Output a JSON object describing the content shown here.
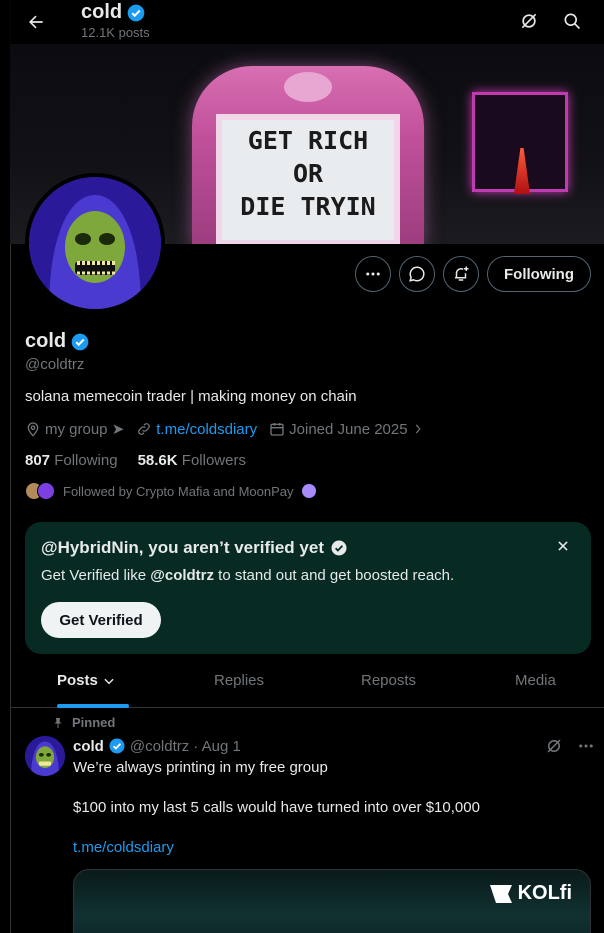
{
  "topbar": {
    "name": "cold",
    "posts_count": "12.1K posts"
  },
  "banner": {
    "sign_lines": [
      "GET RICH",
      "OR",
      "DIE TRYIN"
    ]
  },
  "profile": {
    "name": "cold",
    "handle": "@coldtrz",
    "bio": "solana memecoin trader | making money on chain",
    "location": "my group ➤",
    "link": "t.me/coldsdiary",
    "joined": "Joined June 2025",
    "following_count": "807",
    "following_label": "Following",
    "followers_count": "58.6K",
    "followers_label": "Followers",
    "followed_by": "Followed by Crypto Mafia and MoonPay",
    "following_button": "Following"
  },
  "verify_card": {
    "title": "@HybridNin, you aren’t verified yet",
    "subtitle_prefix": "Get Verified like ",
    "subtitle_handle": "@coldtrz",
    "subtitle_suffix": " to stand out and get boosted reach.",
    "button": "Get Verified"
  },
  "tabs": [
    {
      "label": "Posts"
    },
    {
      "label": "Replies"
    },
    {
      "label": "Reposts"
    },
    {
      "label": "Media"
    }
  ],
  "post": {
    "pinned_label": "Pinned",
    "author": "cold",
    "handle": "@coldtrz",
    "date": "· Aug 1",
    "line1": "We’re always printing in my free group",
    "line2": "$100 into my last 5 calls would have turned into over $10,000",
    "link": "t.me/coldsdiary",
    "media_brand": "KOLfi"
  },
  "colors": {
    "accent": "#1d9bf0",
    "verify_bg": "#072a23",
    "muted": "#71767b"
  }
}
